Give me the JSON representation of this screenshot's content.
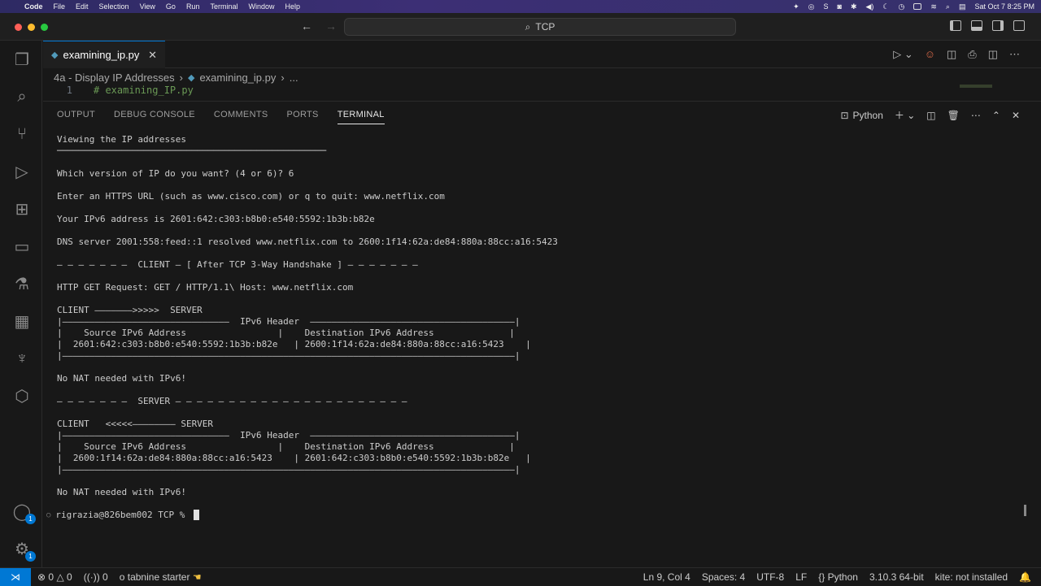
{
  "menubar": {
    "app": "Code",
    "items": [
      "File",
      "Edit",
      "Selection",
      "View",
      "Go",
      "Run",
      "Terminal",
      "Window",
      "Help"
    ],
    "clock": "Sat Oct 7  8:25 PM"
  },
  "window": {
    "command_center": "TCP"
  },
  "editor": {
    "tab_label": "examining_ip.py",
    "breadcrumb": [
      "4a - Display IP Addresses",
      "examining_ip.py",
      "..."
    ],
    "line_number": "1",
    "line_code": "# examining_IP.py"
  },
  "panel": {
    "tabs": [
      "OUTPUT",
      "DEBUG CONSOLE",
      "COMMENTS",
      "PORTS",
      "TERMINAL"
    ],
    "active_tab": "TERMINAL",
    "terminal_profile": "Python"
  },
  "terminal": {
    "lines": [
      "Viewing the IP addresses",
      "──────────────────────────────────────────────────",
      "",
      "Which version of IP do you want? (4 or 6)? 6",
      "",
      "Enter an HTTPS URL (such as www.cisco.com) or q to quit: www.netflix.com",
      "",
      "Your IPv6 address is 2601:642:c303:b8b0:e540:5592:1b3b:b82e",
      "",
      "DNS server 2001:558:feed::1 resolved www.netflix.com to 2600:1f14:62a:de84:880a:88cc:a16:5423",
      "",
      "– – – – – – –  CLIENT – [ After TCP 3-Way Handshake ] – – – – – – –",
      "",
      "HTTP GET Request: GET / HTTP/1.1\\ Host: www.netflix.com",
      "",
      "CLIENT ———————>>>>>  SERVER",
      "|———————————————————————————————  IPv6 Header  ——————————————————————————————————————|",
      "|    Source IPv6 Address                 |    Destination IPv6 Address              |",
      "|  2601:642:c303:b8b0:e540:5592:1b3b:b82e   | 2600:1f14:62a:de84:880a:88cc:a16:5423    |",
      "|————————————————————————————————————————————————————————————————————————————————————|",
      "",
      "No NAT needed with IPv6!",
      "",
      "– – – – – – –  SERVER – – – – – – – – – – – – – – – – – – – – – –",
      "",
      "CLIENT   <<<<<———————— SERVER",
      "|———————————————————————————————  IPv6 Header  ——————————————————————————————————————|",
      "|    Source IPv6 Address                 |    Destination IPv6 Address              |",
      "|  2600:1f14:62a:de84:880a:88cc:a16:5423    | 2601:642:c303:b8b0:e540:5592:1b3b:b82e   |",
      "|————————————————————————————————————————————————————————————————————————————————————|",
      "",
      "No NAT needed with IPv6!"
    ],
    "prompt": "rigrazia@826bem002 TCP % "
  },
  "activity": {
    "accounts_badge": "1",
    "settings_badge": "1"
  },
  "statusbar": {
    "errors": "0",
    "warnings": "0",
    "ports": "0",
    "tabnine": "tabnine starter",
    "position": "Ln 9, Col 4",
    "spaces": "Spaces: 4",
    "encoding": "UTF-8",
    "eol": "LF",
    "language": "Python",
    "interpreter": "3.10.3 64-bit",
    "kite": "kite: not installed"
  },
  "colors": {
    "accent": "#0078d4",
    "comment": "#6a9955",
    "background": "#181818"
  }
}
